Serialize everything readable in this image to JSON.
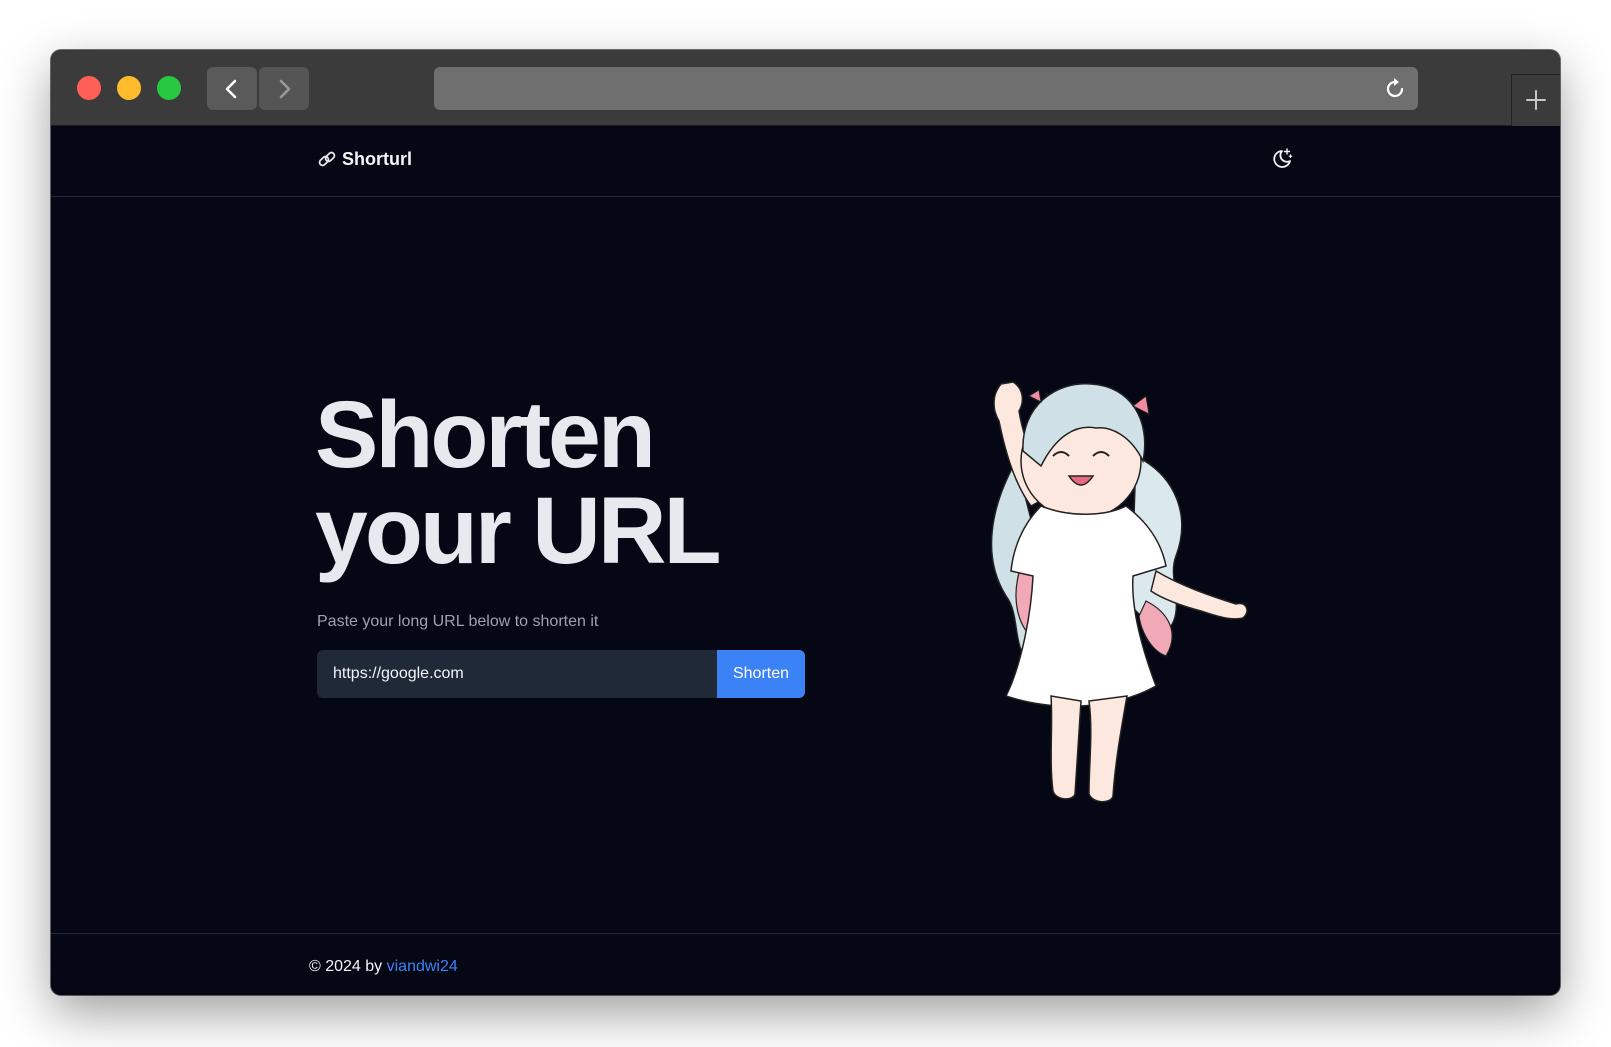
{
  "browser": {
    "address": "",
    "icons": {
      "back": "chevron-left-icon",
      "forward": "chevron-right-icon",
      "reload": "reload-icon",
      "new_tab": "plus-icon"
    }
  },
  "header": {
    "brand_icon": "link-icon",
    "brand_name": "Shorturl",
    "theme_toggle_icon": "moon-stars-icon"
  },
  "hero": {
    "title_line1": "Shorten",
    "title_line2": "your URL",
    "subtitle": "Paste your long URL below to shorten it",
    "input_value": "https://google.com",
    "button_label": "Shorten",
    "illustration": "anime-girl-cheering-illustration"
  },
  "footer": {
    "copyright_prefix": "© 2024 by ",
    "author_link": "viandwi24"
  },
  "colors": {
    "page_bg": "#050814",
    "accent": "#3b82f6",
    "input_bg": "#1f2937",
    "muted_text": "#9ca3af",
    "heading_text": "#e8e9ee"
  }
}
